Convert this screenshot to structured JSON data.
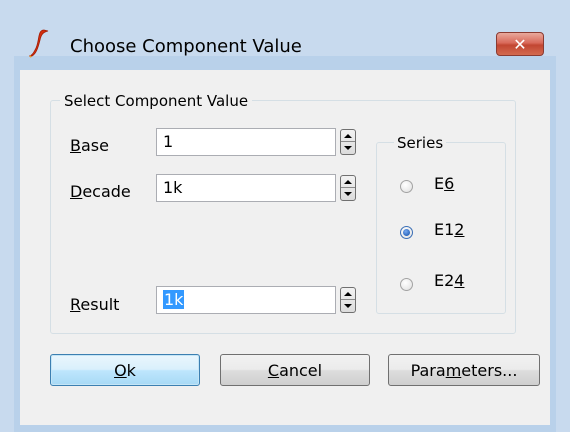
{
  "window": {
    "title": "Choose Component Value",
    "close_glyph": "✕"
  },
  "icons": {
    "app": "simetrix-logo-icon",
    "close": "close-icon"
  },
  "group": {
    "legend": "Select Component Value"
  },
  "fields": {
    "base": {
      "label_mnemonic": "B",
      "label_rest": "ase",
      "value": "1"
    },
    "decade": {
      "label_mnemonic": "D",
      "label_rest": "ecade",
      "value": "1k"
    },
    "result": {
      "label_mnemonic": "R",
      "label_rest": "esult",
      "value": "1k"
    }
  },
  "series": {
    "legend": "Series",
    "options": [
      {
        "prefix": "E",
        "mnemonic": "6",
        "suffix": "",
        "checked": false
      },
      {
        "prefix": "E1",
        "mnemonic": "2",
        "suffix": "",
        "checked": true
      },
      {
        "prefix": "E2",
        "mnemonic": "4",
        "suffix": "",
        "checked": false
      }
    ]
  },
  "buttons": {
    "ok": {
      "mnemonic": "O",
      "rest": "k"
    },
    "cancel": {
      "mnemonic": "C",
      "rest": "ancel"
    },
    "parameters": {
      "pre": "Para",
      "mnemonic": "m",
      "rest": "eters..."
    }
  },
  "colors": {
    "titlebar": "#c8daee",
    "client": "#f0f0f0",
    "selection": "#3399ff",
    "close_button": "#c24632"
  }
}
